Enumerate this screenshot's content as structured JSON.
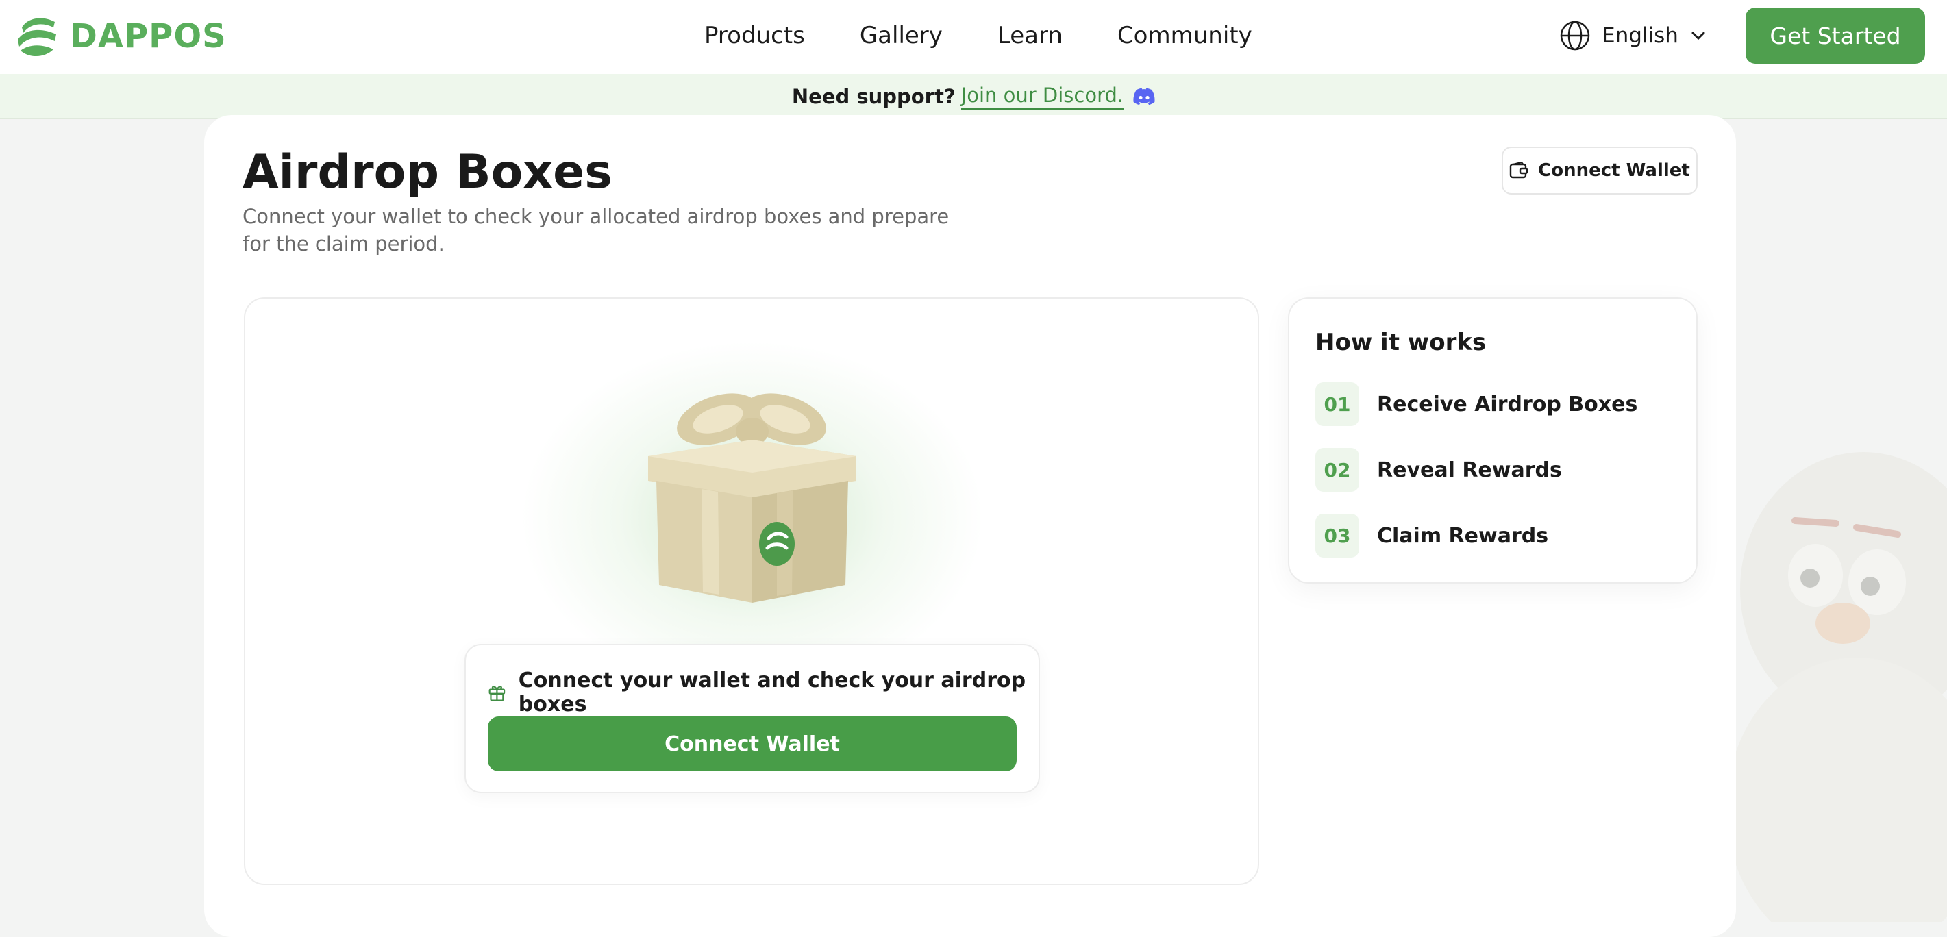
{
  "header": {
    "logo_text": "DAPPOS",
    "nav": [
      "Products",
      "Gallery",
      "Learn",
      "Community"
    ],
    "language": "English",
    "get_started_label": "Get Started"
  },
  "banner": {
    "text": "Need support?",
    "link_text": "Join our Discord."
  },
  "page": {
    "title": "Airdrop Boxes",
    "subtitle": "Connect your wallet to check your allocated airdrop boxes and prepare for the claim period.",
    "connect_wallet_label": "Connect Wallet"
  },
  "airdrop_card": {
    "prompt": "Connect your wallet and check your airdrop boxes",
    "connect_button_label": "Connect Wallet"
  },
  "how_it_works": {
    "title": "How it works",
    "steps": [
      {
        "num": "01",
        "label": "Receive Airdrop Boxes"
      },
      {
        "num": "02",
        "label": "Reveal Rewards"
      },
      {
        "num": "03",
        "label": "Claim Rewards"
      }
    ]
  },
  "colors": {
    "brand_green": "#4f9f4e",
    "banner_bg": "#eef7ec",
    "link_green": "#3f8d43",
    "discord_purple": "#5865f2"
  },
  "icons": [
    "dappos-logo-icon",
    "globe-icon",
    "chevron-down-icon",
    "discord-icon",
    "wallet-icon",
    "gift-icon"
  ]
}
